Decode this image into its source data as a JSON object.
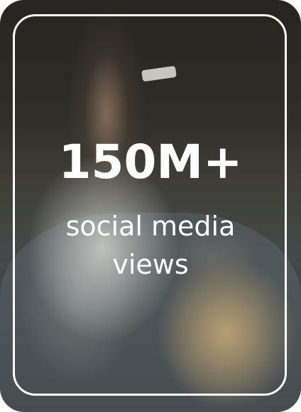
{
  "stat": {
    "value": "150M+",
    "label": "social media views"
  },
  "colors": {
    "text": "#ffffff",
    "frame": "#ffffff"
  }
}
